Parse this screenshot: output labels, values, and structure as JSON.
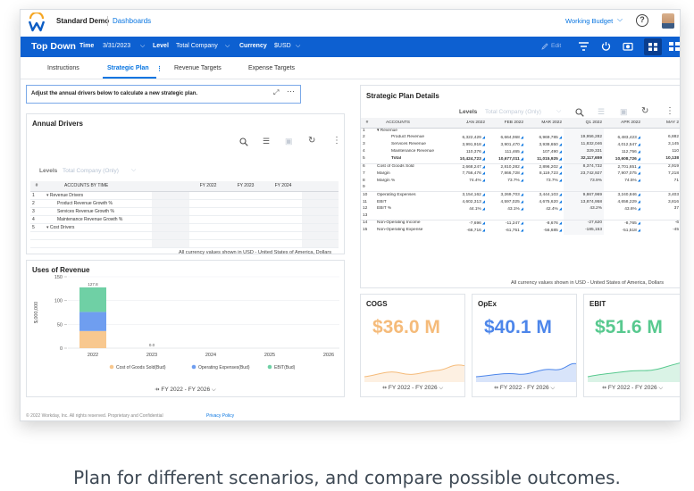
{
  "header": {
    "app_title": "Standard Demo",
    "dashboards_link": "Dashboards",
    "budget_selector": "Working Budget",
    "help_icon": "?"
  },
  "filter_bar": {
    "title": "Top Down",
    "time_label": "Time",
    "time_value": "3/31/2023",
    "level_label": "Level",
    "level_value": "Total Company",
    "currency_label": "Currency",
    "currency_value": "$USD",
    "edit_label": "Edit"
  },
  "tabs": [
    {
      "label": "Instructions"
    },
    {
      "label": "Strategic Plan"
    },
    {
      "label": "Revenue Targets"
    },
    {
      "label": "Expense Targets"
    }
  ],
  "instructions_text": "Adjust the annual drivers below to calculate a new strategic plan.",
  "annual_drivers": {
    "title": "Annual Drivers",
    "levels_label": "Levels",
    "levels_value": "Total Company (Only)",
    "columns": [
      "#",
      "ACCOUNTS BY TIME",
      "FY 2022",
      "FY 2023",
      "FY 2024"
    ],
    "rows": [
      {
        "n": "1",
        "name": "Revenue Drivers"
      },
      {
        "n": "2",
        "name": "Product Revenue Growth %"
      },
      {
        "n": "3",
        "name": "Services Revenue Growth %"
      },
      {
        "n": "4",
        "name": "Maintenance Revenue Growth %"
      },
      {
        "n": "5",
        "name": "Cost Drivers"
      }
    ],
    "note": "All currency values shown in USD - United States of America, Dollars"
  },
  "uses_of_revenue": {
    "title": "Uses of Revenue",
    "range": "FY 2022 - FY 2026"
  },
  "chart_data": {
    "type": "bar",
    "stacked": true,
    "title": "Uses of Revenue",
    "ylabel": "$,000,000",
    "ylim": [
      0,
      150
    ],
    "yticks": [
      0,
      50,
      100,
      150
    ],
    "categories": [
      "2022",
      "2023",
      "2024",
      "2025",
      "2026"
    ],
    "totals_labels": [
      "127.8",
      "0.0",
      "",
      "",
      ""
    ],
    "series": [
      {
        "name": "Cost of Goods Sold(Bud)",
        "color": "#f8c88f",
        "values": [
          36.0,
          0,
          0,
          0,
          0
        ]
      },
      {
        "name": "Operating Expenses(Bud)",
        "color": "#6f9ef0",
        "values": [
          40.1,
          0,
          0,
          0,
          0
        ]
      },
      {
        "name": "EBIT(Bud)",
        "color": "#6fd0a5",
        "values": [
          51.6,
          0,
          0,
          0,
          0
        ]
      }
    ],
    "legend_position": "bottom"
  },
  "strategic_plan": {
    "title": "Strategic Plan Details",
    "levels_label": "Levels",
    "levels_value": "Total Company (Only)",
    "columns": [
      "#",
      "ACCOUNTS",
      "JAN 2022",
      "FEB 2022",
      "MAR 2022",
      "Q1 2022",
      "APR 2022",
      "MAY 2"
    ],
    "rows": [
      {
        "n": "1",
        "name": "Revenue",
        "indent": 0,
        "caret": true,
        "v": [
          "",
          "",
          "",
          "",
          "",
          ""
        ]
      },
      {
        "n": "2",
        "name": "Product Revenue",
        "indent": 2,
        "v": [
          "6,322,429",
          "6,664,068",
          "6,969,785",
          "19,956,282",
          "6,483,423",
          "6,882"
        ]
      },
      {
        "n": "3",
        "name": "Services Revenue",
        "indent": 2,
        "v": [
          "3,991,918",
          "3,901,470",
          "3,938,650",
          "11,832,046",
          "4,012,547",
          "3,145"
        ]
      },
      {
        "n": "4",
        "name": "Maintenance Revenue",
        "indent": 2,
        "v": [
          "110,376",
          "111,465",
          "107,490",
          "329,331",
          "112,756",
          "110"
        ]
      },
      {
        "n": "5",
        "name": "Total",
        "indent": 2,
        "bold": true,
        "v": [
          "10,424,723",
          "10,677,011",
          "11,015,925",
          "32,117,659",
          "10,608,726",
          "10,138"
        ]
      },
      {
        "n": "6",
        "name": "Cost of Goods Sold",
        "indent": 0,
        "v": [
          "2,668,247",
          "2,810,282",
          "2,896,202",
          "8,374,732",
          "2,701,651",
          "2,919"
        ]
      },
      {
        "n": "7",
        "name": "Margin",
        "indent": 0,
        "v": [
          "7,756,476",
          "7,866,728",
          "8,119,723",
          "23,742,927",
          "7,907,075",
          "7,218"
        ]
      },
      {
        "n": "8",
        "name": "Margin %",
        "indent": 0,
        "v": [
          "74.4%",
          "73.7%",
          "73.7%",
          "73.9%",
          "74.5%",
          "71"
        ]
      },
      {
        "n": "9",
        "name": "",
        "indent": 0,
        "v": [
          "",
          "",
          "",
          "",
          "",
          ""
        ]
      },
      {
        "n": "10",
        "name": "Operating Expenses",
        "indent": 0,
        "v": [
          "3,154,162",
          "3,269,703",
          "3,444,103",
          "9,867,969",
          "3,240,846",
          "3,403"
        ]
      },
      {
        "n": "11",
        "name": "EBIT",
        "indent": 0,
        "v": [
          "4,602,313",
          "4,597,025",
          "4,675,620",
          "13,874,958",
          "4,658,229",
          "3,816"
        ]
      },
      {
        "n": "12",
        "name": "EBIT %",
        "indent": 0,
        "v": [
          "44.1%",
          "43.1%",
          "42.4%",
          "43.2%",
          "43.6%",
          "37"
        ]
      },
      {
        "n": "13",
        "name": "",
        "indent": 0,
        "v": [
          "",
          "",
          "",
          "",
          "",
          ""
        ]
      },
      {
        "n": "14",
        "name": "Non-Operating Income",
        "indent": 0,
        "v": [
          "-7,696",
          "-11,247",
          "-8,676",
          "-27,620",
          "-8,765",
          "-6"
        ]
      },
      {
        "n": "15",
        "name": "Non-Operating Expense",
        "indent": 0,
        "v": [
          "-66,716",
          "-61,751",
          "-56,685",
          "-185,153",
          "-51,518",
          "-45"
        ]
      }
    ],
    "note": "All currency values shown in USD - United States of America, Dollars"
  },
  "kpis": [
    {
      "title": "COGS",
      "value": "$36.0 M",
      "color": "#f5bb7a",
      "range": "FY 2022 - FY 2026"
    },
    {
      "title": "OpEx",
      "value": "$40.1 M",
      "color": "#4d86ea",
      "range": "FY 2022 - FY 2026"
    },
    {
      "title": "EBIT",
      "value": "$51.6 M",
      "color": "#58c98f",
      "range": "FY 2022 - FY 2026"
    }
  ],
  "footer": {
    "copyright": "© 2022 Workday, Inc. All rights reserved. Proprietary and Confidential",
    "privacy": "Privacy Policy"
  },
  "caption": "Plan for different scenarios, and compare possible outcomes."
}
